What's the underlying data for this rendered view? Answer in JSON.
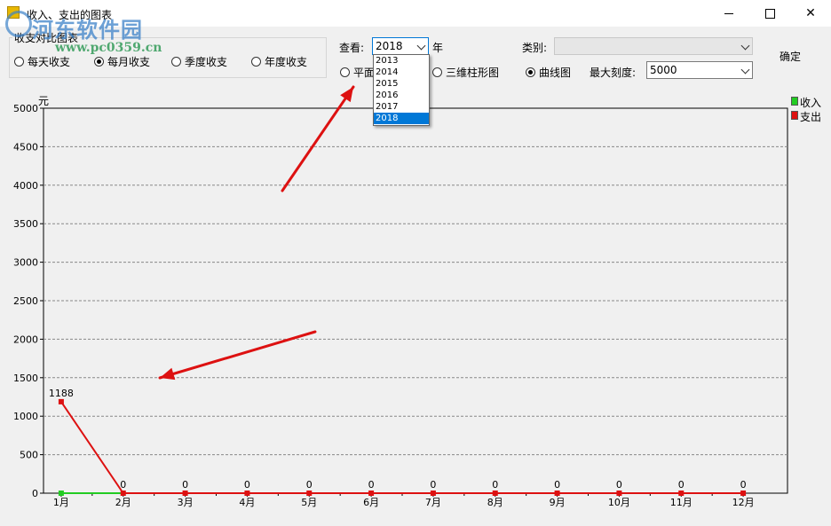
{
  "window": {
    "title": "收入、支出的图表"
  },
  "watermark": {
    "main": "河东软件园",
    "sub": "www.pc0359.cn"
  },
  "period": {
    "legend": "收支对比图表",
    "options": [
      {
        "label": "每天收支",
        "selected": false
      },
      {
        "label": "每月收支",
        "selected": true
      },
      {
        "label": "季度收支",
        "selected": false
      },
      {
        "label": "年度收支",
        "selected": false
      }
    ]
  },
  "view": {
    "label": "查看:",
    "year_value": "2018",
    "year_suffix": "年",
    "year_options": [
      "2013",
      "2014",
      "2015",
      "2016",
      "2017",
      "2018"
    ],
    "selected_year": "2018"
  },
  "category": {
    "label": "类别:",
    "value": ""
  },
  "chart_style": {
    "options": [
      {
        "label": "平面",
        "selected": false
      },
      {
        "label": "三维柱形图",
        "selected": false
      },
      {
        "label": "曲线图",
        "selected": true
      }
    ]
  },
  "max_scale": {
    "label": "最大刻度:",
    "value": "5000"
  },
  "ok_label": "确定",
  "colors": {
    "income": "#22cc22",
    "expense": "#dd1111",
    "arrow": "#dd1111"
  },
  "chart_data": {
    "type": "line",
    "ylabel": "元",
    "ylim": [
      0,
      5000
    ],
    "yticks": [
      0,
      500,
      1000,
      1500,
      2000,
      2500,
      3000,
      3500,
      4000,
      4500,
      5000
    ],
    "categories": [
      "1月",
      "2月",
      "3月",
      "4月",
      "5月",
      "6月",
      "7月",
      "8月",
      "9月",
      "10月",
      "11月",
      "12月"
    ],
    "grid": "horizontal dashed",
    "legend_position": "right",
    "series": [
      {
        "name": "收入",
        "color": "#22cc22",
        "values": [
          0,
          0,
          0,
          0,
          0,
          0,
          0,
          0,
          0,
          0,
          0,
          0
        ]
      },
      {
        "name": "支出",
        "color": "#dd1111",
        "values": [
          1188,
          0,
          0,
          0,
          0,
          0,
          0,
          0,
          0,
          0,
          0,
          0
        ]
      }
    ],
    "point_labels": [
      "1188",
      "0",
      "0",
      "0",
      "0",
      "0",
      "0",
      "0",
      "0",
      "0",
      "0",
      "0"
    ],
    "income_point_label": "0"
  }
}
